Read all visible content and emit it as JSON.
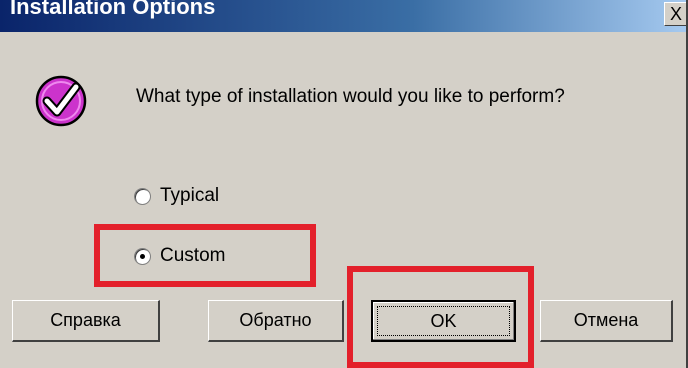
{
  "window": {
    "title": "Installation Options",
    "close_glyph": "X"
  },
  "message": {
    "icon": "checkmark-icon",
    "text": "What type of installation would you like to perform?"
  },
  "options": {
    "selected": "Custom",
    "items": [
      {
        "label": "Typical",
        "checked": false
      },
      {
        "label": "Custom",
        "checked": true
      }
    ]
  },
  "buttons": {
    "help_label": "Справка",
    "back_label": "Обратно",
    "ok_label": "OK",
    "cancel_label": "Отмена"
  },
  "colors": {
    "dialog_bg": "#d4d0c8",
    "title_bar": "#0a246a",
    "highlight": "#e3202b",
    "icon_fill": "#cc33cc"
  }
}
